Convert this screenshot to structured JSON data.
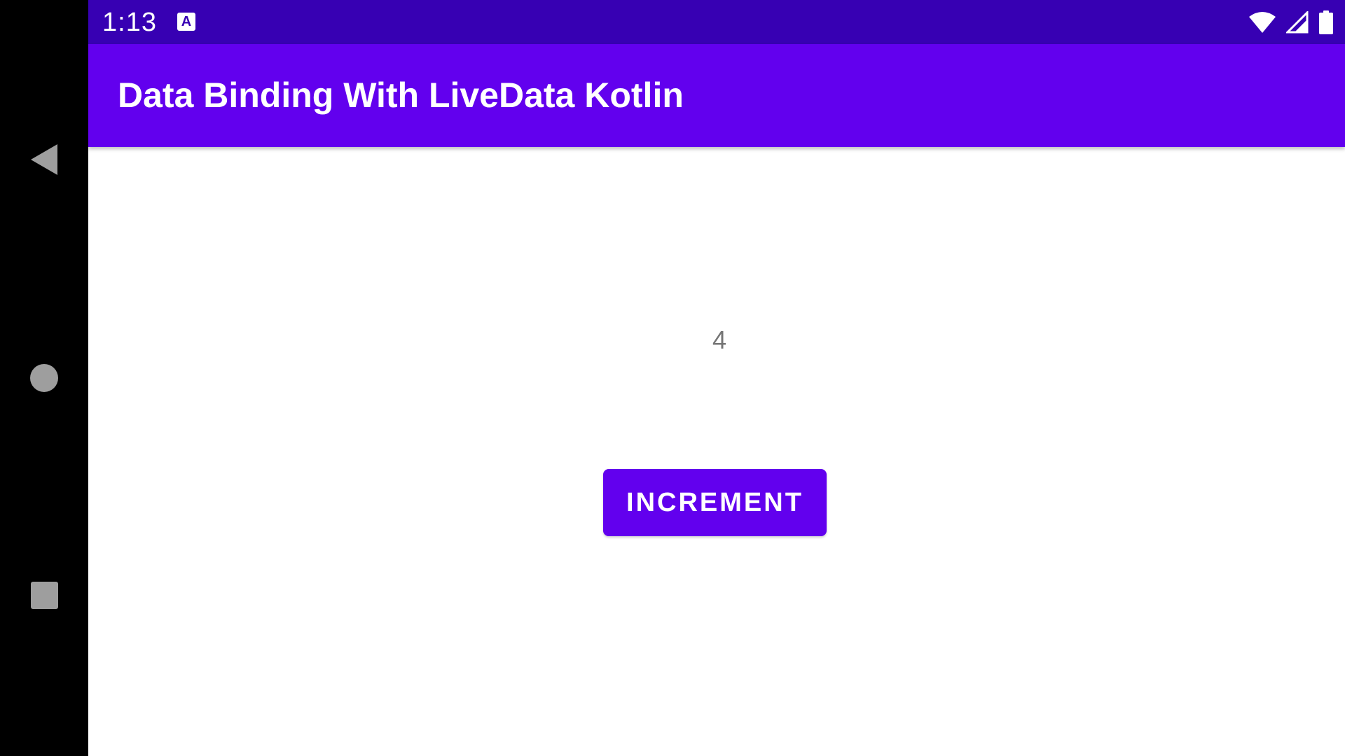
{
  "status_bar": {
    "time": "1:13",
    "app_notification_icon": "text-input-icon",
    "app_notification_glyph": "A",
    "icons": [
      "wifi-icon",
      "cellular-signal-icon",
      "battery-icon"
    ],
    "background_color": "#3700b3"
  },
  "nav_bar": {
    "buttons": [
      "back-icon",
      "home-icon",
      "recents-icon"
    ]
  },
  "app_bar": {
    "title": "Data Binding With LiveData Kotlin",
    "background_color": "#6200ee"
  },
  "main": {
    "counter_value": "4",
    "increment_label": "INCREMENT",
    "accent_color": "#6200ee"
  }
}
